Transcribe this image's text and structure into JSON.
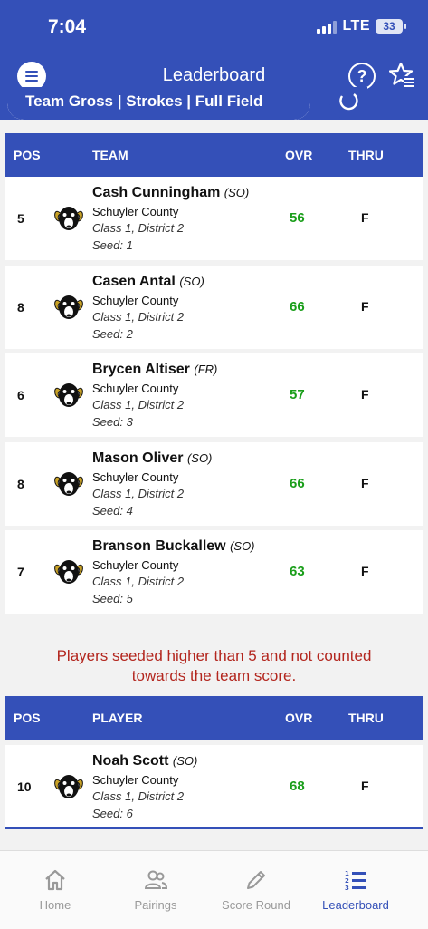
{
  "status": {
    "time": "7:04",
    "network": "LTE",
    "battery": "33"
  },
  "header": {
    "title": "Leaderboard",
    "help_icon": "question-circle-icon",
    "fav_icon": "star-list-icon"
  },
  "filter": {
    "label": "Team Gross | Strokes | Full Field"
  },
  "team_table": {
    "headers": {
      "pos": "POS",
      "name": "TEAM",
      "ovr": "OVR",
      "thru": "THRU"
    },
    "rows": [
      {
        "pos": "5",
        "name": "Cash Cunningham",
        "year": "(SO)",
        "school": "Schuyler County",
        "class": "Class 1, District 2",
        "seed": "Seed: 1",
        "ovr": "56",
        "thru": "F"
      },
      {
        "pos": "8",
        "name": "Casen Antal",
        "year": "(SO)",
        "school": "Schuyler County",
        "class": "Class 1, District 2",
        "seed": "Seed: 2",
        "ovr": "66",
        "thru": "F"
      },
      {
        "pos": "6",
        "name": "Brycen Altiser",
        "year": "(FR)",
        "school": "Schuyler County",
        "class": "Class 1, District 2",
        "seed": "Seed: 3",
        "ovr": "57",
        "thru": "F"
      },
      {
        "pos": "8",
        "name": "Mason Oliver",
        "year": "(SO)",
        "school": "Schuyler County",
        "class": "Class 1, District 2",
        "seed": "Seed: 4",
        "ovr": "66",
        "thru": "F"
      },
      {
        "pos": "7",
        "name": "Branson Buckallew",
        "year": "(SO)",
        "school": "Schuyler County",
        "class": "Class 1, District 2",
        "seed": "Seed: 5",
        "ovr": "63",
        "thru": "F"
      }
    ]
  },
  "note": {
    "line1": "Players seeded higher than 5 and not counted",
    "line2": "towards the team score."
  },
  "player_table": {
    "headers": {
      "pos": "POS",
      "name": "PLAYER",
      "ovr": "OVR",
      "thru": "THRU"
    },
    "rows": [
      {
        "pos": "10",
        "name": "Noah Scott",
        "year": "(SO)",
        "school": "Schuyler County",
        "class": "Class 1, District 2",
        "seed": "Seed: 6",
        "ovr": "68",
        "thru": "F"
      }
    ]
  },
  "tabs": [
    {
      "label": "Home",
      "icon": "home-icon"
    },
    {
      "label": "Pairings",
      "icon": "people-icon"
    },
    {
      "label": "Score Round",
      "icon": "pencil-icon"
    },
    {
      "label": "Leaderboard",
      "icon": "leaderboard-list-icon",
      "active": true
    }
  ],
  "colors": {
    "brand": "#3450b8",
    "score_green": "#1a9e1a",
    "note_red": "#b3261e"
  }
}
